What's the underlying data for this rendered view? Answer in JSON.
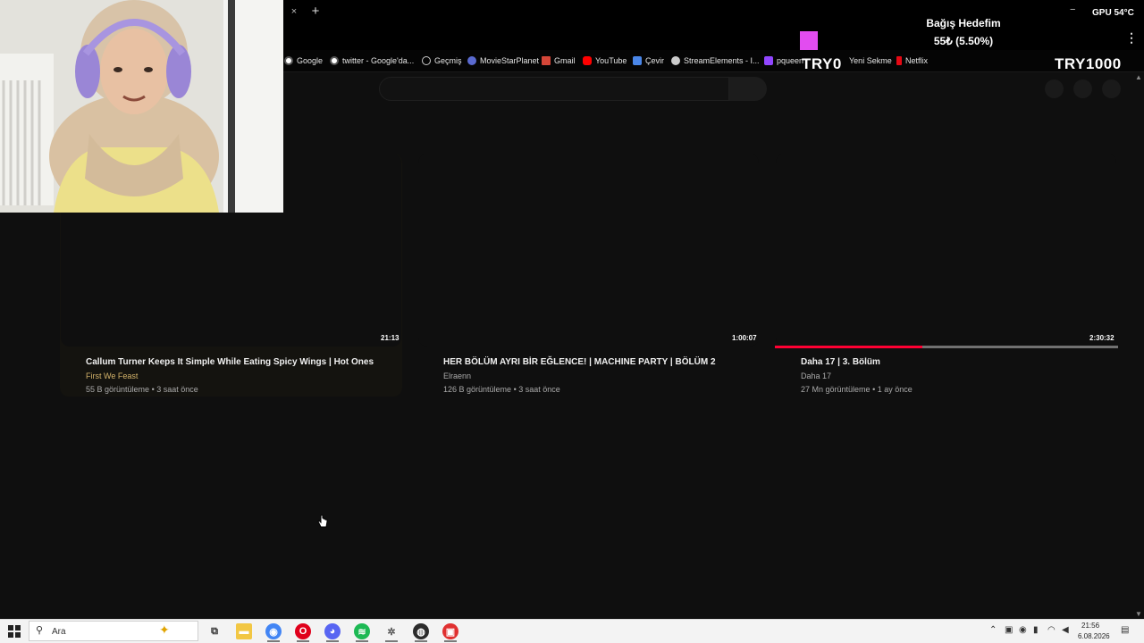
{
  "browser": {
    "tab_close": "×",
    "new_tab": "+",
    "minimize": "−",
    "menu": "⋮",
    "bookmarks": [
      {
        "label": "Google",
        "icon": "google-icon",
        "color": "#555555"
      },
      {
        "label": "twitter - Google'da...",
        "icon": "google-icon",
        "color": "#555555"
      },
      {
        "label": "Geçmiş",
        "icon": "history-icon",
        "color": "#555555"
      },
      {
        "label": "MovieStarPlanet",
        "icon": "moviestarplanet-icon",
        "color": "#5a6ad0"
      },
      {
        "label": "Gmail",
        "icon": "gmail-icon",
        "color": "#d44638"
      },
      {
        "label": "YouTube",
        "icon": "youtube-icon",
        "color": "#ff0000"
      },
      {
        "label": "Çevir",
        "icon": "translate-icon",
        "color": "#4a86e8"
      },
      {
        "label": "StreamElements - I...",
        "icon": "streamelements-icon",
        "color": "#cccccc"
      },
      {
        "label": "pqueen",
        "icon": "twitch-icon",
        "color": "#9146ff"
      },
      {
        "label": "Yeni Sekme",
        "icon": "new-tab-icon",
        "color": "#555555"
      },
      {
        "label": "Netflix",
        "icon": "netflix-icon",
        "color": "#e50914"
      }
    ]
  },
  "overlay": {
    "donation_title": "Bağış Hedefim",
    "donation_progress": "55₺ (5.50%)",
    "gpu": "GPU 54°C",
    "goal_start": "TRY0",
    "goal_end": "TRY1000",
    "goal_fraction": 0.055,
    "goal_color": "#e24cf0"
  },
  "videos": [
    {
      "title": "Callum Turner Keeps It Simple While Eating Spicy Wings | Hot Ones",
      "channel": "First We Feast",
      "views": "55 B görüntüleme",
      "age": "3 saat önce",
      "duration": "21:13",
      "channel_color": "#d4b36a"
    },
    {
      "title": "HER BÖLÜM AYRI BİR EĞLENCE! | MACHINE PARTY | BÖLÜM 2",
      "channel": "Elraenn",
      "views": "126 B görüntüleme",
      "age": "3 saat önce",
      "duration": "1:00:07",
      "channel_color": "#aaaaaa"
    },
    {
      "title": "Daha 17 | 3. Bölüm",
      "channel": "Daha 17",
      "views": "27 Mn görüntüleme",
      "age": "1 ay önce",
      "duration": "2:30:32",
      "channel_color": "#aaaaaa",
      "watch_progress": 0.43
    }
  ],
  "meta_separator": "•",
  "taskbar": {
    "search_placeholder": "Ara",
    "apps": [
      {
        "name": "task-view",
        "icon": "task-view-icon",
        "color": "#333333"
      },
      {
        "name": "file-explorer",
        "icon": "folder-icon",
        "color": "#f2c744"
      },
      {
        "name": "chrome",
        "icon": "chrome-icon",
        "color": "#4285f4"
      },
      {
        "name": "opera",
        "icon": "opera-icon",
        "color": "#e0001b"
      },
      {
        "name": "discord",
        "icon": "discord-icon",
        "color": "#5865f2"
      },
      {
        "name": "spotify",
        "icon": "spotify-icon",
        "color": "#1db954"
      },
      {
        "name": "settings",
        "icon": "settings-icon",
        "color": "#555555"
      },
      {
        "name": "obs",
        "icon": "obs-icon",
        "color": "#2b2b2b"
      },
      {
        "name": "app-red",
        "icon": "app-icon",
        "color": "#e03030"
      }
    ],
    "clock_time": "21:56",
    "clock_date": "6.08.2026"
  }
}
